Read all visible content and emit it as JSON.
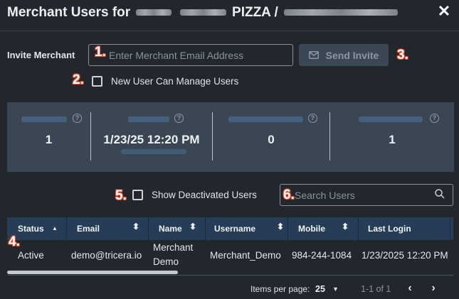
{
  "dialog": {
    "title_prefix": "Merchant Users for",
    "title_visible": "PIZZA /",
    "close_glyph": "✕"
  },
  "invite": {
    "label": "Invite Merchant",
    "email_placeholder": "Enter Merchant Email Address",
    "send_label": "Send Invite",
    "send_icon": "envelope-icon",
    "can_manage_label": "New User Can Manage Users",
    "can_manage_checked": false
  },
  "annotations": [
    "1.",
    "2.",
    "3.",
    "4.",
    "5.",
    "6."
  ],
  "stats": [
    {
      "value": "1"
    },
    {
      "value": "1/23/25 12:20 PM"
    },
    {
      "value": "0"
    },
    {
      "value": "1"
    }
  ],
  "filters": {
    "show_deactivated_label": "Show Deactivated Users",
    "show_deactivated_checked": false,
    "search_placeholder": "Search Users"
  },
  "table": {
    "columns": [
      {
        "label": "Status",
        "sort": "▲"
      },
      {
        "label": "Email",
        "sort": "⬍"
      },
      {
        "label": "Name",
        "sort": "⬍"
      },
      {
        "label": "Username",
        "sort": "⬍"
      },
      {
        "label": "Mobile",
        "sort": "⬍"
      },
      {
        "label": "Last Login",
        "sort": ""
      }
    ],
    "rows": [
      {
        "status": "Active",
        "email": "demo@tricera.io",
        "name_line1": "Merchant",
        "name_line2": "Demo",
        "username": "Merchant_Demo",
        "mobile": "984-244-1084",
        "last_login": "1/23/2025 12:20 PM"
      }
    ]
  },
  "pager": {
    "items_per_page_label": "Items per page:",
    "page_size": "25",
    "range": "1-1 of 1",
    "prev_glyph": "‹",
    "next_glyph": "›"
  },
  "colors": {
    "background": "#22272e",
    "stats_panel": "#3a4654",
    "table_header": "#263c57",
    "annotation": "#e84b2a"
  }
}
